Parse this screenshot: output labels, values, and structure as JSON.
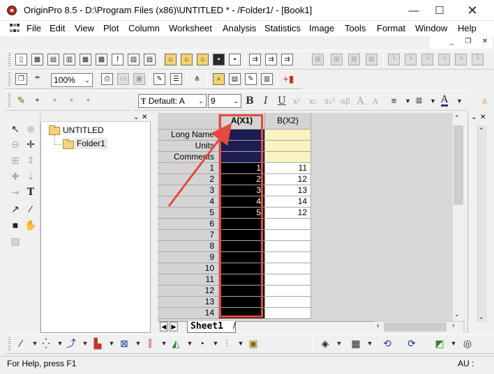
{
  "window": {
    "title": "OriginPro 8.5 - D:\\Program Files (x86)\\UNTITLED * - /Folder1/ - [Book1]",
    "minimize": "—",
    "maximize": "☐",
    "close": "✕"
  },
  "menu": [
    "File",
    "Edit",
    "View",
    "Plot",
    "Column",
    "Worksheet",
    "Analysis",
    "Statistics",
    "Image",
    "Tools",
    "Format",
    "Window",
    "Help"
  ],
  "mdi": {
    "minimize": "_",
    "restore": "❐",
    "close": "✕"
  },
  "toolbar": {
    "zoom_value": "100%",
    "font_value": "Default: A",
    "size_value": "9",
    "bold": "B",
    "italic": "I",
    "underline": "U",
    "superscript": "x²",
    "subscript": "x₂",
    "supersub": "x₁²",
    "greek": "αβ",
    "grow_font": "A",
    "shrink_font": "A",
    "font_color": "A"
  },
  "explorer": {
    "root": "UNTITLED",
    "child": "Folder1"
  },
  "worksheet": {
    "columns": [
      "A(X1)",
      "B(X2)"
    ],
    "meta_labels": [
      "Long Name",
      "Units",
      "Comments"
    ],
    "rows": [
      {
        "n": "1",
        "a": "1",
        "b": "11"
      },
      {
        "n": "2",
        "a": "2",
        "b": "12"
      },
      {
        "n": "3",
        "a": "3",
        "b": "13"
      },
      {
        "n": "4",
        "a": "4",
        "b": "14"
      },
      {
        "n": "5",
        "a": "5",
        "b": "12"
      },
      {
        "n": "6",
        "a": "",
        "b": ""
      },
      {
        "n": "7",
        "a": "",
        "b": ""
      },
      {
        "n": "8",
        "a": "",
        "b": ""
      },
      {
        "n": "9",
        "a": "",
        "b": ""
      },
      {
        "n": "10",
        "a": "",
        "b": ""
      },
      {
        "n": "11",
        "a": "",
        "b": ""
      },
      {
        "n": "12",
        "a": "",
        "b": ""
      },
      {
        "n": "13",
        "a": "",
        "b": ""
      },
      {
        "n": "14",
        "a": "",
        "b": ""
      }
    ],
    "sheet_tab": "Sheet1"
  },
  "status": {
    "help_text": "For Help, press F1",
    "mode": "AU :"
  },
  "colors": {
    "highlight": "#e8483f",
    "selected_column": "#000000",
    "selected_meta": "#1c1d52",
    "meta_yellow": "#f8f3c0"
  }
}
